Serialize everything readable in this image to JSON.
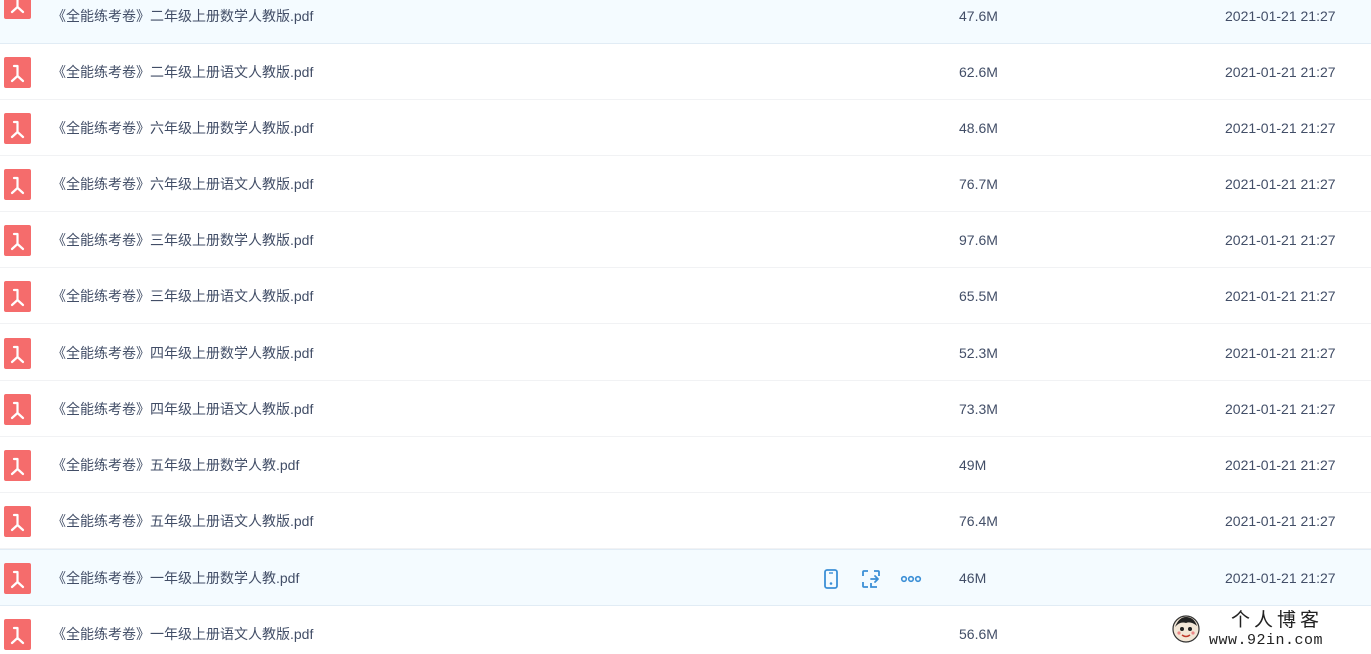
{
  "files": [
    {
      "name": "《全能练考卷》二年级上册数学人教版.pdf",
      "size": "47.6M",
      "time": "2021-01-21 21:27"
    },
    {
      "name": "《全能练考卷》二年级上册语文人教版.pdf",
      "size": "62.6M",
      "time": "2021-01-21 21:27"
    },
    {
      "name": "《全能练考卷》六年级上册数学人教版.pdf",
      "size": "48.6M",
      "time": "2021-01-21 21:27"
    },
    {
      "name": "《全能练考卷》六年级上册语文人教版.pdf",
      "size": "76.7M",
      "time": "2021-01-21 21:27"
    },
    {
      "name": "《全能练考卷》三年级上册数学人教版.pdf",
      "size": "97.6M",
      "time": "2021-01-21 21:27"
    },
    {
      "name": "《全能练考卷》三年级上册语文人教版.pdf",
      "size": "65.5M",
      "time": "2021-01-21 21:27"
    },
    {
      "name": "《全能练考卷》四年级上册数学人教版.pdf",
      "size": "52.3M",
      "time": "2021-01-21 21:27"
    },
    {
      "name": "《全能练考卷》四年级上册语文人教版.pdf",
      "size": "73.3M",
      "time": "2021-01-21 21:27"
    },
    {
      "name": "《全能练考卷》五年级上册数学人教.pdf",
      "size": "49M",
      "time": "2021-01-21 21:27"
    },
    {
      "name": "《全能练考卷》五年级上册语文人教版.pdf",
      "size": "76.4M",
      "time": "2021-01-21 21:27"
    },
    {
      "name": "《全能练考卷》一年级上册数学人教.pdf",
      "size": "46M",
      "time": "2021-01-21 21:27"
    },
    {
      "name": "《全能练考卷》一年级上册语文人教版.pdf",
      "size": "56.6M",
      "time": ""
    }
  ],
  "row_actions": {
    "icons": [
      "phone-icon",
      "share-icon",
      "more-icon"
    ]
  },
  "watermark": {
    "title": "个人博客",
    "url": "www.92in.com"
  },
  "colors": {
    "text": "#424e67",
    "pdf_icon": "#f56c6c",
    "action_icon": "#3b8fd6",
    "row_highlight": "#f4fbff"
  }
}
